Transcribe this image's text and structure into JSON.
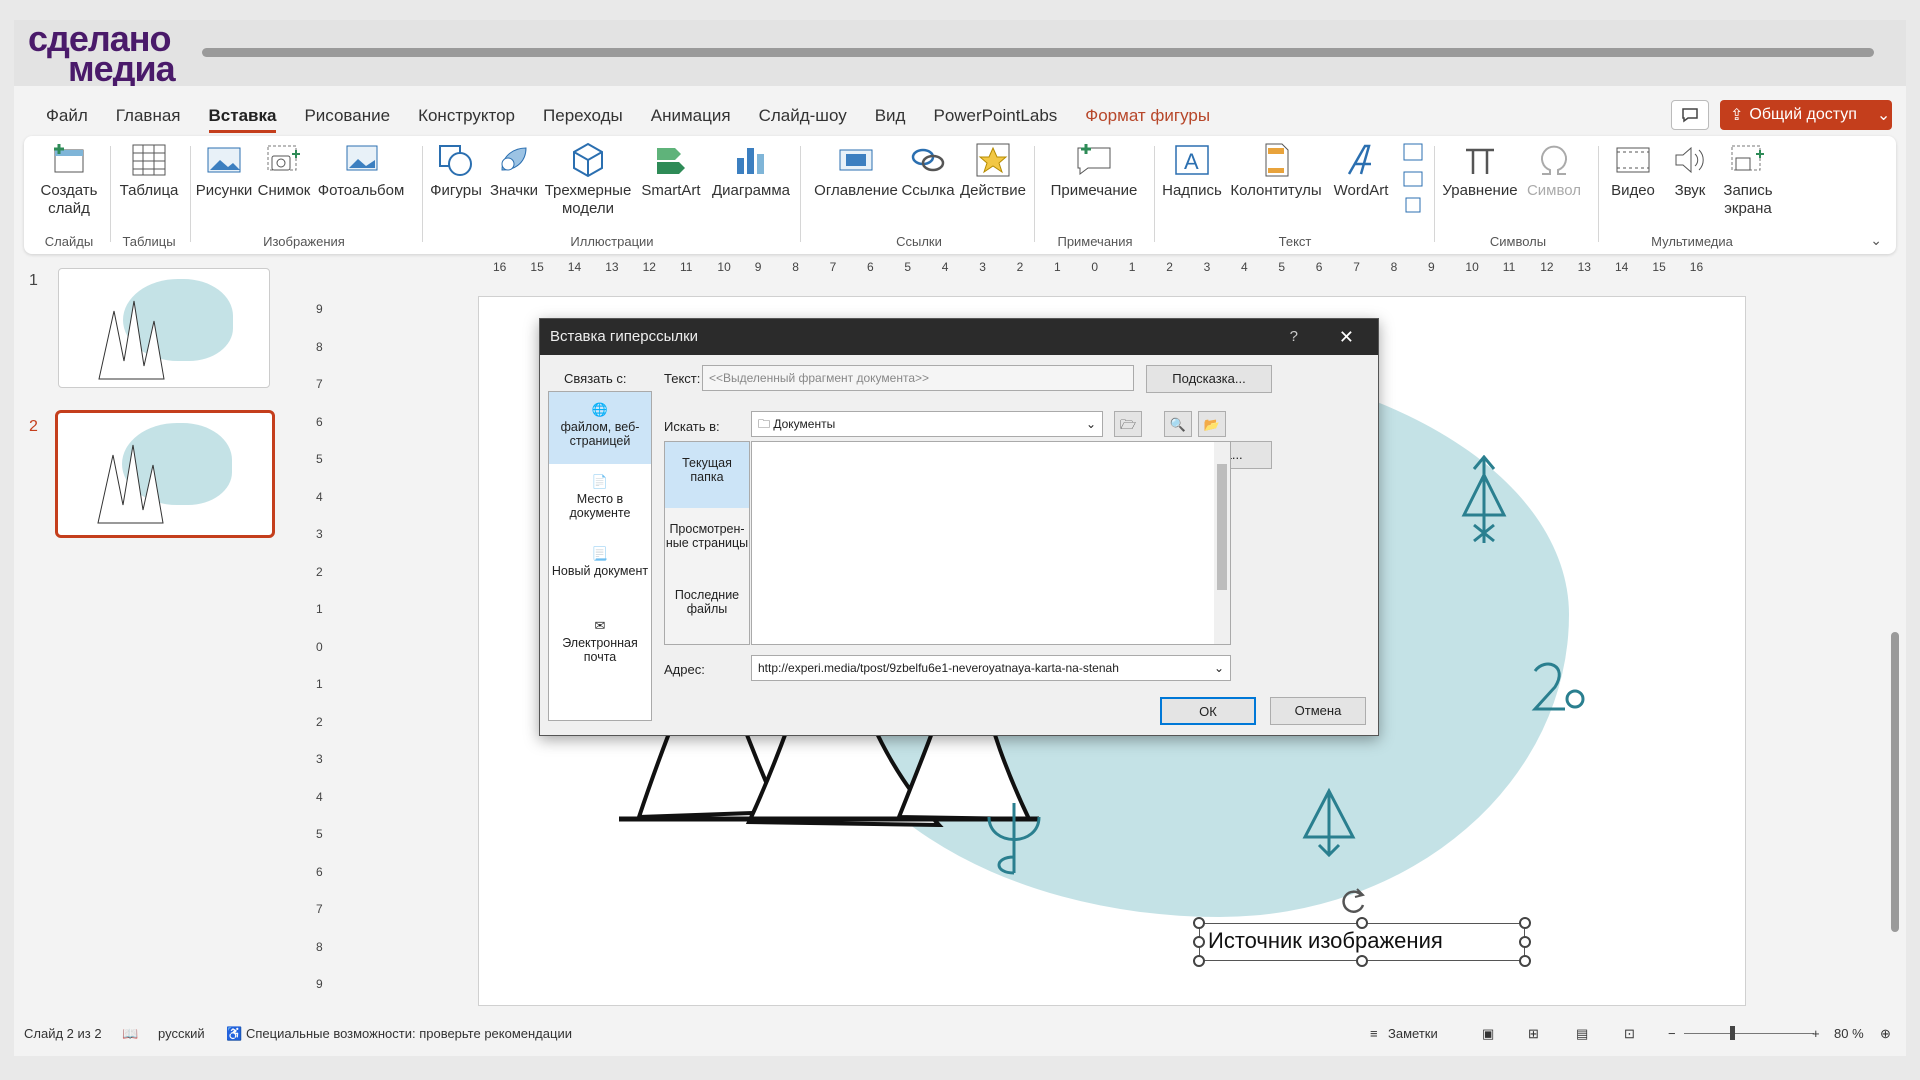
{
  "brand": {
    "line1": "сделано",
    "line2": "медиа"
  },
  "menu": {
    "tabs": [
      "Файл",
      "Главная",
      "Вставка",
      "Рисование",
      "Конструктор",
      "Переходы",
      "Анимация",
      "Слайд-шоу",
      "Вид",
      "PowerPointLabs",
      "Формат фигуры"
    ],
    "active": "Вставка",
    "share": "Общий доступ"
  },
  "ribbon": {
    "create_slide": "Создать слайд",
    "table": "Таблица",
    "pictures": "Рисунки",
    "screenshot": "Снимок",
    "photoalbum": "Фотоальбом",
    "shapes": "Фигуры",
    "icons": "Значки",
    "models3d": "Трехмерные модели",
    "smartart": "SmartArt",
    "chart": "Диаграмма",
    "toc": "Оглавление",
    "link": "Ссылка",
    "action": "Действие",
    "comment": "Примечание",
    "textbox": "Надпись",
    "header_footer": "Колонтитулы",
    "wordart": "WordArt",
    "equation": "Уравнение",
    "symbol": "Символ",
    "video": "Видео",
    "audio": "Звук",
    "screen_record": "Запись экрана",
    "groups": {
      "slides": "Слайды",
      "tables": "Таблицы",
      "images": "Изображения",
      "illustrations": "Иллюстрации",
      "links": "Ссылки",
      "comments": "Примечания",
      "text": "Текст",
      "symbols": "Символы",
      "media": "Мультимедиа"
    }
  },
  "thumbs": {
    "n1": "1",
    "n2": "2"
  },
  "ruler": {
    "h": [
      "16",
      "15",
      "14",
      "13",
      "12",
      "11",
      "10",
      "9",
      "8",
      "7",
      "6",
      "5",
      "4",
      "3",
      "2",
      "1",
      "0",
      "1",
      "2",
      "3",
      "4",
      "5",
      "6",
      "7",
      "8",
      "9",
      "10",
      "11",
      "12",
      "13",
      "14",
      "15",
      "16"
    ],
    "v": [
      "9",
      "8",
      "7",
      "6",
      "5",
      "4",
      "3",
      "2",
      "1",
      "0",
      "1",
      "2",
      "3",
      "4",
      "5",
      "6",
      "7",
      "8",
      "9"
    ]
  },
  "slide": {
    "caption": "Источник изображения"
  },
  "dialog": {
    "title": "Вставка гиперссылки",
    "help": "?",
    "link_to": "Связать с:",
    "link_items": [
      "файлом, веб-страницей",
      "Место в документе",
      "Новый документ",
      "Электронная почта"
    ],
    "text_label": "Текст:",
    "text_value": "<<Выделенный фрагмент документа>>",
    "hint_btn": "Подсказка...",
    "lookin_label": "Искать в:",
    "lookin_value": "Документы",
    "bookmark_btn": "Закладка...",
    "side_items": [
      "Текущая папка",
      "Просмотрен-ные страницы",
      "Последние файлы"
    ],
    "address_label": "Адрес:",
    "address_value": "http://experi.media/tpost/9zbelfu6e1-neveroyatnaya-karta-na-stenah",
    "ok": "ОК",
    "cancel": "Отмена"
  },
  "status": {
    "slide": "Слайд 2 из 2",
    "lang": "русский",
    "accessibility": "Специальные возможности: проверьте рекомендации",
    "notes": "Заметки",
    "zoom": "80 %"
  },
  "colors": {
    "accent": "#c43e1c",
    "brand": "#4a1a6a",
    "blob": "#c4e2e6",
    "teal": "#2a7f8f"
  }
}
